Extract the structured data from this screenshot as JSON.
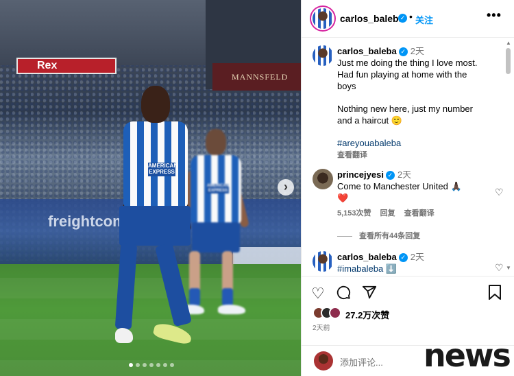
{
  "post": {
    "username": "carlos_baleba",
    "follow_label": "关注",
    "separator": "•",
    "more_label": "•••",
    "carousel_dots": 7,
    "active_dot": 0
  },
  "photo": {
    "board_left": "Rex",
    "board_right": "MANNSFELD",
    "adboard_text": "freightcom",
    "sponsor": "AMERICAN EXPRESS"
  },
  "caption": {
    "username": "carlos_baleba",
    "time": "2天",
    "line1": "Just me doing the thing I love most.",
    "line2": "Had fun playing at home with the",
    "line3": "boys",
    "line4": "Nothing new here, just my number",
    "line5": "and a haircut 🙂",
    "hashtag": "#areyouabaleba",
    "translate": "查看翻译"
  },
  "comments": [
    {
      "username": "princejyesi",
      "time": "2天",
      "text": "Come to Manchester United 🙏🏿",
      "emoji": "❤️",
      "likes": "5,153次赞",
      "reply": "回复",
      "translate": "查看翻译",
      "view_replies": "查看所有44条回复"
    },
    {
      "username": "carlos_baleba",
      "time": "2天",
      "text": "#imabaleba ⬇️"
    }
  ],
  "actions": {
    "likes": "27.2万次赞",
    "posted_ago": "2天前",
    "add_comment_placeholder": "添加评论..."
  },
  "watermark": "news",
  "colors": {
    "accent": "#0095f6",
    "hashtag": "#00376b",
    "muted": "#737373"
  }
}
